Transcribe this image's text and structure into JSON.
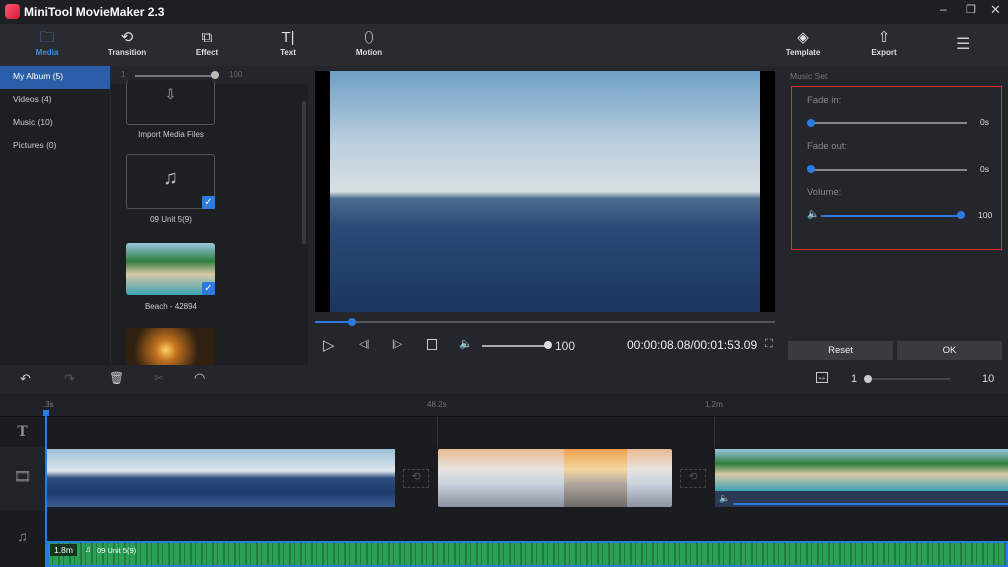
{
  "app": {
    "title": "MiniTool MovieMaker 2.3"
  },
  "toolbar": {
    "items": [
      {
        "label": "Media",
        "icon": "folder-icon"
      },
      {
        "label": "Transition",
        "icon": "transition-icon"
      },
      {
        "label": "Effect",
        "icon": "effect-icon"
      },
      {
        "label": "Text",
        "icon": "text-icon"
      },
      {
        "label": "Motion",
        "icon": "motion-icon"
      }
    ],
    "template": "Template",
    "export": "Export"
  },
  "sidebar": {
    "items": [
      {
        "label": "My Album",
        "count": "(5)"
      },
      {
        "label": "Videos",
        "count": "(4)"
      },
      {
        "label": "Music",
        "count": "(10)"
      },
      {
        "label": "Pictures",
        "count": "(0)"
      }
    ]
  },
  "media": {
    "zoom_min": "1",
    "zoom_max": "100",
    "items": [
      {
        "label": "Import Media Files"
      },
      {
        "label": "09 Unit 5(9)"
      },
      {
        "label": "Beach - 42894"
      }
    ]
  },
  "player": {
    "volume": "100",
    "time": "00:00:08.08/00:01:53.09",
    "progress": 0.08
  },
  "music_set": {
    "title": "Music Set",
    "fade_in_label": "Fade in:",
    "fade_in_value": "0s",
    "fade_out_label": "Fade out:",
    "fade_out_value": "0s",
    "volume_label": "Volume:",
    "volume_value": "100",
    "reset": "Reset",
    "ok": "OK"
  },
  "timeline": {
    "zoom_min": "1",
    "zoom_max": "10",
    "ruler": [
      ".3s",
      "48.2s",
      "1.2m"
    ],
    "audio_duration": "1.8m",
    "audio_name": "09 Unit 5(9)"
  },
  "colors": {
    "accent": "#2d7be0",
    "audio": "#2aa055",
    "highlight": "#e03030"
  }
}
